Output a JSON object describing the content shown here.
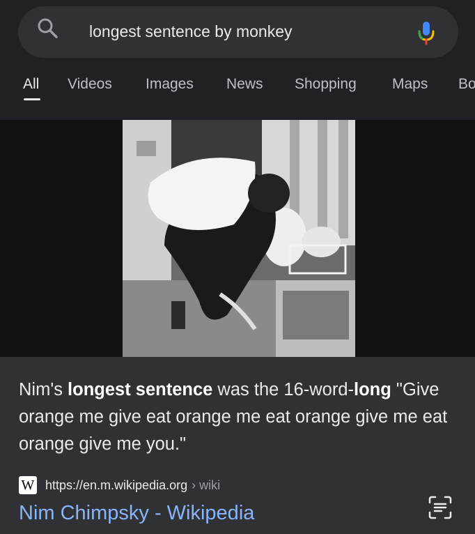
{
  "search": {
    "query": "longest sentence by monkey"
  },
  "tabs": [
    {
      "label": "All",
      "active": true
    },
    {
      "label": "Videos",
      "active": false
    },
    {
      "label": "Images",
      "active": false
    },
    {
      "label": "News",
      "active": false
    },
    {
      "label": "Shopping",
      "active": false
    },
    {
      "label": "Maps",
      "active": false
    },
    {
      "label": "Bo",
      "active": false
    }
  ],
  "featured_snippet": {
    "parts": [
      {
        "text": "Nim's ",
        "bold": false
      },
      {
        "text": "longest sentence",
        "bold": true
      },
      {
        "text": " was the 16-word-",
        "bold": false
      },
      {
        "text": "long",
        "bold": true
      },
      {
        "text": " \"Give orange me give eat orange me eat orange give me eat orange give me you.\"",
        "bold": false
      }
    ],
    "source_icon": "W",
    "source_url": "https://en.m.wikipedia.org",
    "source_breadcrumb": "› wiki",
    "title": "Nim Chimpsky - Wikipedia"
  },
  "icons": {
    "search": "search-icon",
    "mic": "mic-icon",
    "wiki": "wikipedia-icon",
    "lens": "lens-text-icon"
  },
  "colors": {
    "background": "#202124",
    "search_bar": "#303134",
    "link": "#8ab4f8",
    "mic_blue": "#4285f4",
    "mic_red": "#ea4335",
    "mic_yellow": "#fbbc05",
    "mic_green": "#34a853"
  }
}
